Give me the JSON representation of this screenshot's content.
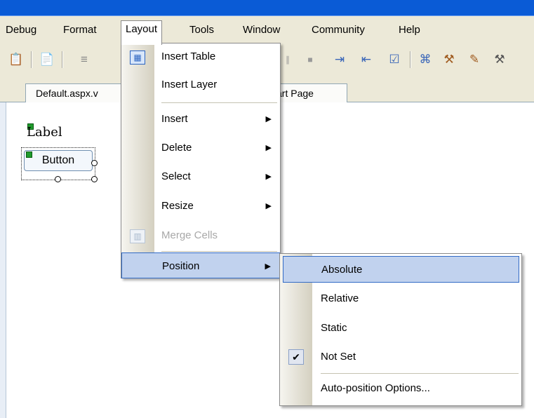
{
  "menubar": {
    "items": [
      "Debug",
      "Format",
      "Layout",
      "Tools",
      "Window",
      "Community",
      "Help"
    ],
    "open": "Layout"
  },
  "toolbar": {
    "icons": [
      "paste-icon",
      "properties-icon",
      "align-icon",
      "split-icon",
      "stop-icon",
      "indent-icon",
      "outdent-icon",
      "task-icon",
      "server-explorer-icon",
      "toolbox-icon",
      "macro-icon",
      "tools-icon"
    ]
  },
  "tabs": [
    {
      "label": "Default.aspx.v"
    },
    {
      "label": "art Page"
    }
  ],
  "designer": {
    "label_text": "Label",
    "button_text": "Button"
  },
  "layout_menu": {
    "items": [
      {
        "label": "Insert Table",
        "icon": "table-icon"
      },
      {
        "label": "Insert Layer"
      },
      {
        "label": "Insert",
        "submenu": true
      },
      {
        "label": "Delete",
        "submenu": true
      },
      {
        "label": "Select",
        "submenu": true
      },
      {
        "label": "Resize",
        "submenu": true
      },
      {
        "label": "Merge Cells",
        "disabled": true,
        "icon": "merge-cells-icon"
      },
      {
        "label": "Position",
        "submenu": true,
        "highlighted": true
      }
    ]
  },
  "position_submenu": {
    "items": [
      {
        "label": "Absolute",
        "highlighted": true
      },
      {
        "label": "Relative"
      },
      {
        "label": "Static"
      },
      {
        "label": "Not Set",
        "checked": true
      },
      {
        "label": "Auto-position Options..."
      }
    ]
  },
  "colors": {
    "title_bar": "#0a5bd6",
    "menu_bg": "#ece9d8",
    "highlight": "#c1d2ee",
    "highlight_border": "#316ac5"
  }
}
